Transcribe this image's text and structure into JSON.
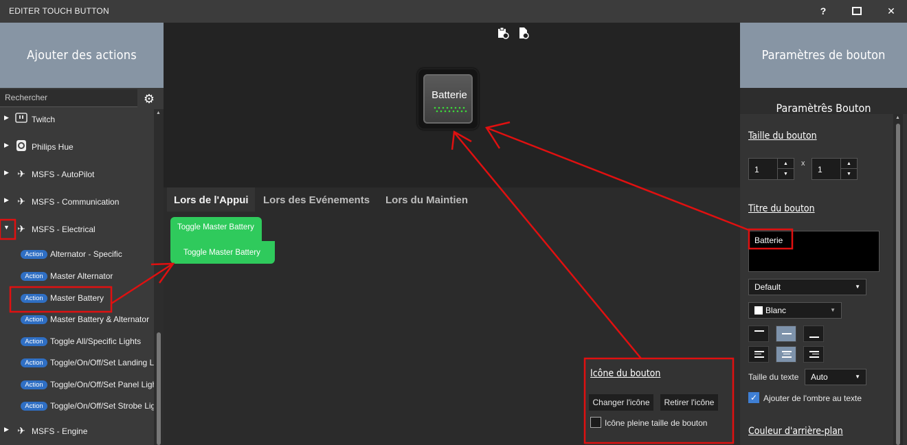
{
  "window": {
    "title": "EDITER TOUCH BUTTON",
    "help": "?",
    "maximize": "☐",
    "close": "✕"
  },
  "left": {
    "header": "Ajouter des actions",
    "search_placeholder": "Rechercher",
    "categories": [
      {
        "label": "Twitch",
        "icon": "twitch-icon"
      },
      {
        "label": "Philips Hue",
        "icon": "philips-hue-icon"
      },
      {
        "label": "MSFS - AutoPilot",
        "icon": "plane-icon"
      },
      {
        "label": "MSFS - Communication",
        "icon": "plane-icon"
      },
      {
        "label": "MSFS - Electrical",
        "icon": "plane-icon",
        "expanded": true
      },
      {
        "label": "MSFS - Engine",
        "icon": "plane-icon"
      }
    ],
    "action_badge": "Action",
    "actions": [
      "Alternator - Specific",
      "Master Alternator",
      "Master Battery",
      "Master Battery & Alternator",
      "Toggle All/Specific Lights",
      "Toggle/On/Off/Set Landing L",
      "Toggle/On/Off/Set Panel Ligh",
      "Toggle/On/Off/Set Strobe Lig"
    ]
  },
  "center": {
    "preview_label": "Batterie",
    "tabs": [
      "Lors de l'Appui",
      "Lors des Evénements",
      "Lors du Maintien"
    ],
    "action_items": [
      "Toggle Master Battery",
      "Toggle Master Battery"
    ],
    "icon_panel": {
      "title": "Icône du bouton",
      "change": "Changer l'icône",
      "remove": "Retirer l'icône",
      "fullsize": "Icône pleine taille de bouton"
    }
  },
  "right": {
    "header": "Paramètres de bouton",
    "subheader": "Paramètres Bouton",
    "size_title": "Taille du bouton",
    "width": "1",
    "height": "1",
    "times": "x",
    "title_title": "Titre du bouton",
    "title_value": "Batterie",
    "font": "Default",
    "color": "Blanc",
    "text_size_label": "Taille du texte",
    "text_size": "Auto",
    "shadow_label": "Ajouter de l'ombre au texte",
    "bg_title": "Couleur d'arrière-plan"
  },
  "colors": {
    "accent_green": "#2fca5c",
    "header_blue": "#8795a4",
    "badge_blue": "#2f6fc4",
    "annotation_red": "#e01010"
  }
}
